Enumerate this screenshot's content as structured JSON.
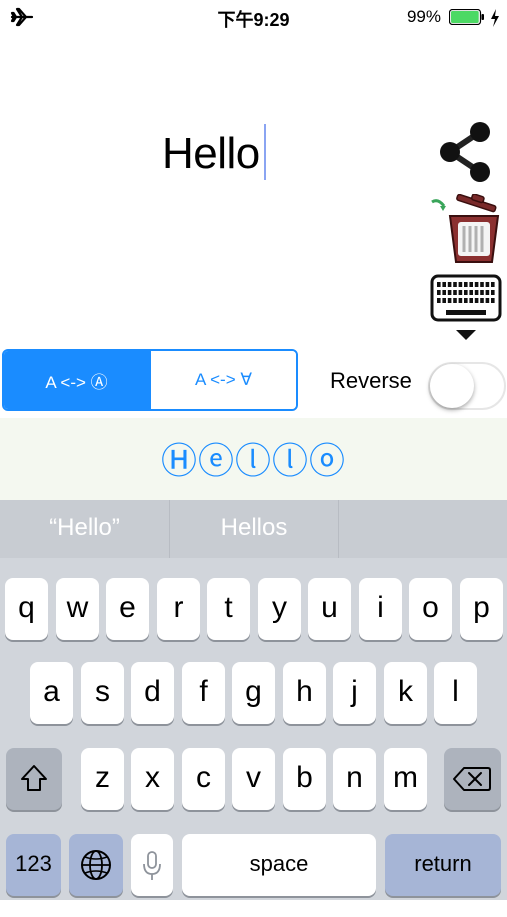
{
  "status_bar": {
    "time": "下午9:29",
    "battery_percent": "99%",
    "airplane_icon": "airplane-icon",
    "battery_icon": "battery-charging-icon",
    "battery_level": 0.99,
    "colors": {
      "battery": "#4cd964"
    }
  },
  "editor": {
    "text": "Hello",
    "share_icon": "share-icon",
    "trash_icon": "trash-icon",
    "keyboard_icon": "keyboard-icon"
  },
  "modes": {
    "options": [
      "A <-> Ⓐ",
      "A <-> ∀"
    ],
    "selected_index": 0,
    "reverse_label": "Reverse",
    "reverse_on": false
  },
  "output": {
    "text": "Ⓗⓔⓛⓛⓞ"
  },
  "keyboard": {
    "suggestions": [
      "“Hello”",
      "Hellos"
    ],
    "row1": [
      "q",
      "w",
      "e",
      "r",
      "t",
      "y",
      "u",
      "i",
      "o",
      "p"
    ],
    "row2": [
      "a",
      "s",
      "d",
      "f",
      "g",
      "h",
      "j",
      "k",
      "l"
    ],
    "row3": [
      "z",
      "x",
      "c",
      "v",
      "b",
      "n",
      "m"
    ],
    "numbers_label": "123",
    "space_label": "space",
    "return_label": "return",
    "shift_icon": "shift-icon",
    "delete_icon": "delete-icon",
    "globe_icon": "globe-icon",
    "mic_icon": "microphone-icon"
  },
  "colors": {
    "accent": "#1a8cff"
  }
}
